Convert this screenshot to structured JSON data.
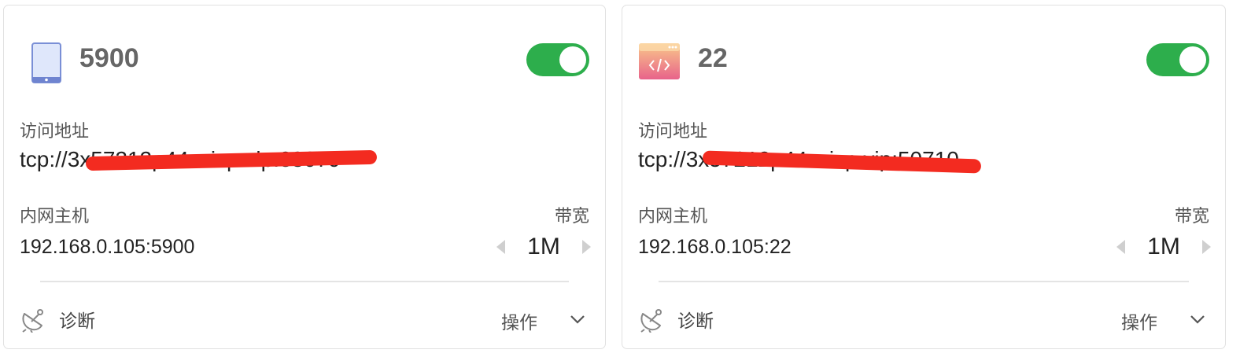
{
  "cards": [
    {
      "icon": "tablet-icon",
      "title": "5900",
      "enabled": true,
      "address_label": "访问地址",
      "address": "tcp://3x57212p44.wicp.vip:38079",
      "host_label": "内网主机",
      "host": "192.168.0.105:5900",
      "bandwidth_label": "带宽",
      "bandwidth": "1M",
      "diagnose_label": "诊断",
      "ops_label": "操作"
    },
    {
      "icon": "code-window-icon",
      "title": "22",
      "enabled": true,
      "address_label": "访问地址",
      "address": "tcp://3x57212p44.wicp.vip:50710",
      "host_label": "内网主机",
      "host": "192.168.0.105:22",
      "bandwidth_label": "带宽",
      "bandwidth": "1M",
      "diagnose_label": "诊断",
      "ops_label": "操作"
    }
  ],
  "colors": {
    "toggle_on": "#2dae4c",
    "redaction": "#f32b20"
  }
}
